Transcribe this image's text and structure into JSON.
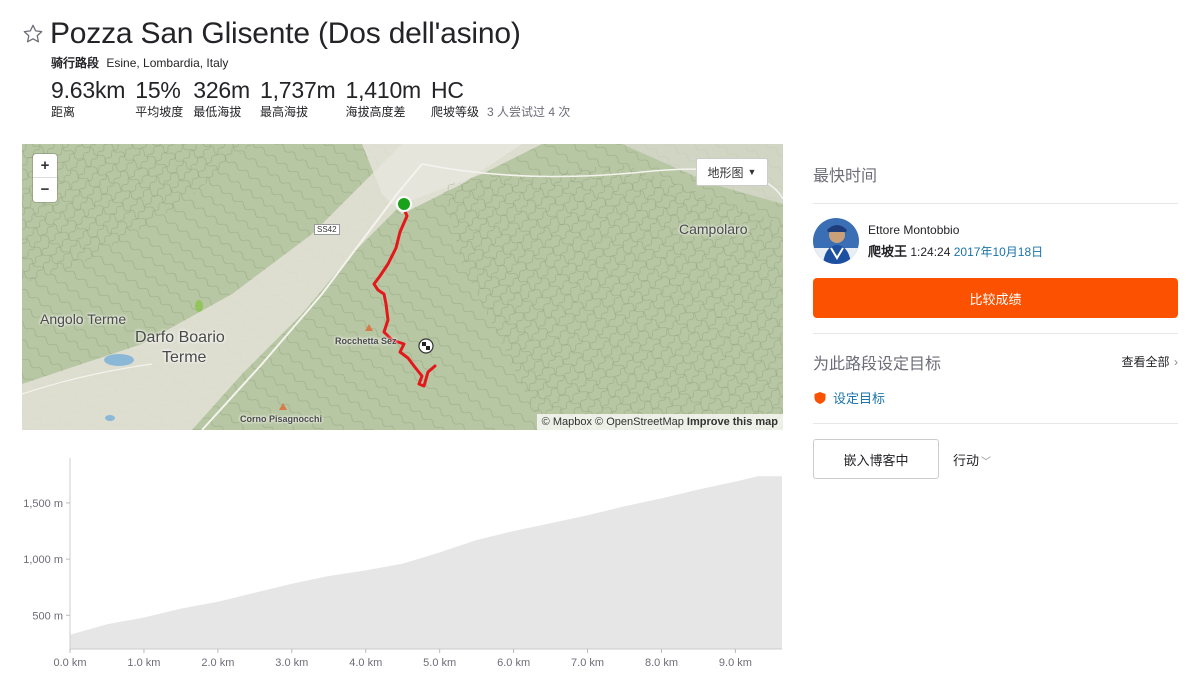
{
  "segment": {
    "title": "Pozza San Glisente (Dos dell'asino)",
    "activity_type": "骑行路段",
    "location": "Esine, Lombardia, Italy"
  },
  "stats": [
    {
      "value": "9.63km",
      "label": "距离"
    },
    {
      "value": "15%",
      "label": "平均坡度"
    },
    {
      "value": "326m",
      "label": "最低海拔"
    },
    {
      "value": "1,737m",
      "label": "最高海拔"
    },
    {
      "value": "1,410m",
      "label": "海拔高度差"
    },
    {
      "value": "HC",
      "label": "爬坡等级"
    }
  ],
  "attempts_text": "3 人尝试过 4 次",
  "map": {
    "zoom_in": "+",
    "zoom_out": "−",
    "type_label": "地形图",
    "places": {
      "angolo_terme": "Angolo Terme",
      "darfo_boario": "Darfo Boario",
      "terme": "Terme",
      "campolaro": "Campolaro",
      "rocchetta": "Rocchetta Sez",
      "corno": "Corno Pisagnocchi",
      "road": "SS42"
    },
    "attribution_mapbox": "© Mapbox",
    "attribution_osm": "© OpenStreetMap",
    "improve": "Improve this map",
    "route_color": "#e4181b",
    "start_color": "#1aa31a"
  },
  "chart_data": {
    "type": "area",
    "x_ticks": [
      "0.0 km",
      "1.0 km",
      "2.0 km",
      "3.0 km",
      "4.0 km",
      "5.0 km",
      "6.0 km",
      "7.0 km",
      "8.0 km",
      "9.0 km"
    ],
    "y_ticks": [
      "500 m",
      "1,000 m",
      "1,500 m"
    ],
    "xlim": [
      0,
      9.63
    ],
    "ylim": [
      200,
      1900
    ],
    "x": [
      0,
      0.5,
      1.0,
      1.5,
      2.0,
      2.5,
      3.0,
      3.5,
      4.0,
      4.5,
      5.0,
      5.5,
      6.0,
      6.5,
      7.0,
      7.5,
      8.0,
      8.5,
      9.0,
      9.3,
      9.63
    ],
    "y": [
      326,
      420,
      480,
      560,
      620,
      700,
      780,
      850,
      900,
      960,
      1060,
      1170,
      1250,
      1320,
      1390,
      1470,
      1540,
      1620,
      1690,
      1737,
      1737
    ],
    "fill_color": "#e6e6e6"
  },
  "right_panel": {
    "fastest_title": "最快时间",
    "leader_name": "Ettore Montobbio",
    "kom_label": "爬坡王",
    "time": "1:24:24",
    "date": "2017年10月18日",
    "compare_label": "比较成绩",
    "goals_title": "为此路段设定目标",
    "view_all": "查看全部",
    "set_goal": "设定目标",
    "embed_label": "嵌入博客中",
    "action_label": "行动",
    "accent": "#fc5200"
  }
}
